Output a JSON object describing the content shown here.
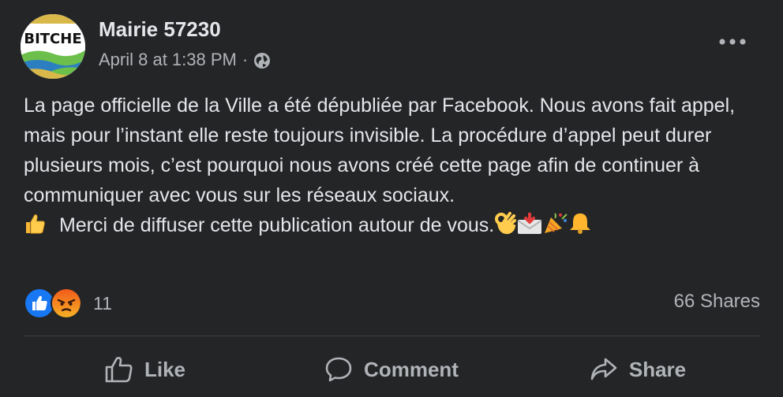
{
  "post": {
    "author": "Mairie 57230",
    "avatar_text": "BITCHE",
    "timestamp": "April 8 at 1:38 PM",
    "separator": "·",
    "audience_icon": "globe-icon",
    "more_icon": "more-options-icon",
    "body_paragraph": "La page officielle de la Ville a été dépubliée par Facebook. Nous avons fait appel, mais pour l’instant elle reste toujours invisible. La procédure d’appel peut durer plusieurs mois, c’est pourquoi nous avons créé cette page afin de continuer à communiquer avec vous sur les réseaux sociaux.",
    "body_line2": "Merci de diffuser cette publication autour de vous.",
    "emojis": [
      "thumbs-up-emoji",
      "ok-hand-emoji",
      "incoming-envelope-emoji",
      "party-popper-emoji",
      "bell-emoji"
    ]
  },
  "reactions": {
    "types": [
      "like-reaction-icon",
      "angry-reaction-icon"
    ],
    "count": "11"
  },
  "shares": "66 Shares",
  "actions": {
    "like": "Like",
    "comment": "Comment",
    "share": "Share"
  },
  "colors": {
    "background": "#242526",
    "primary_text": "#e4e6eb",
    "secondary_text": "#b0b3b8",
    "like_blue": "#1877f2",
    "angry_orange": "#f25a1b"
  }
}
